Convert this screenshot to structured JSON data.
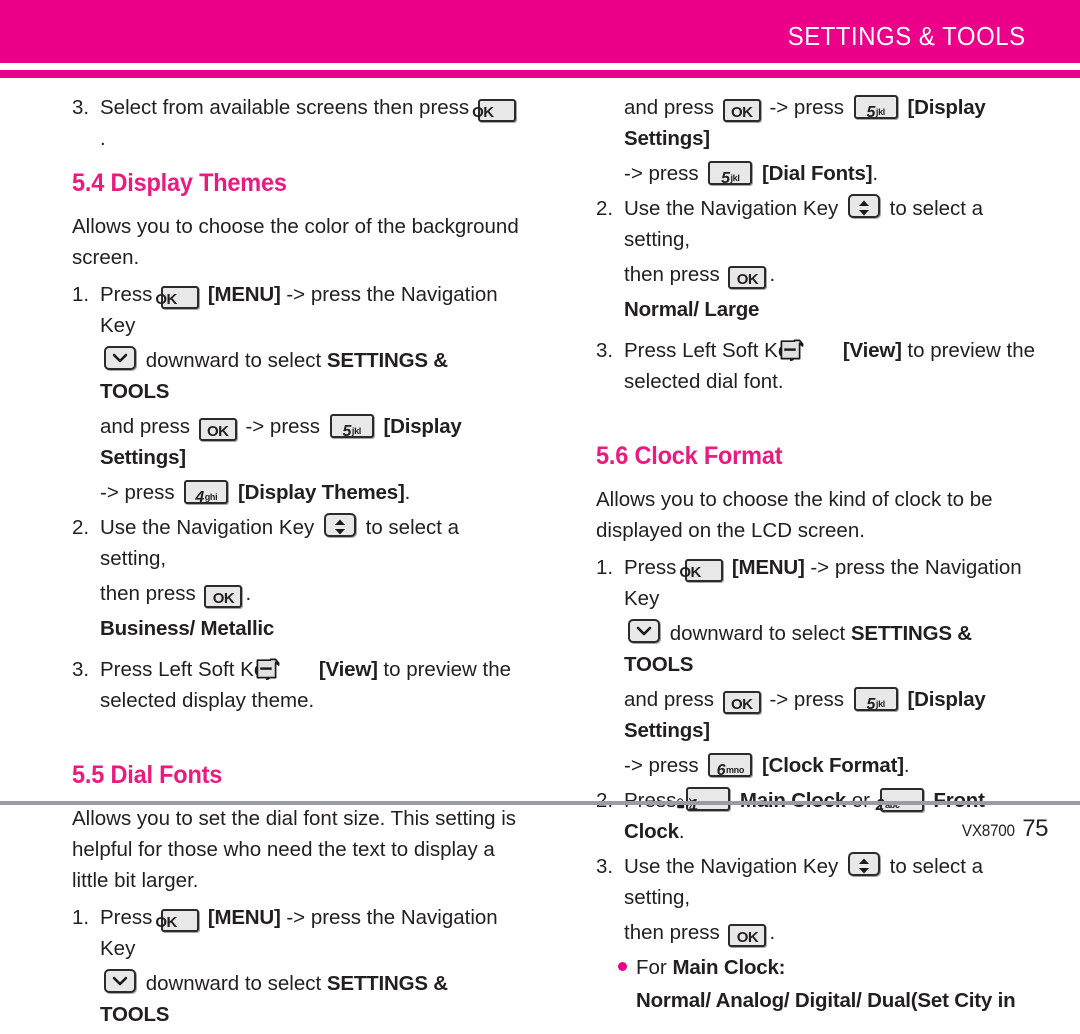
{
  "header": {
    "title": "SETTINGS & TOOLS",
    "band_color": "#ec0089"
  },
  "footer": {
    "model": "VX8700",
    "page": "75",
    "rule_color": "#9b9ba8"
  },
  "theme": {
    "heading_color": "#ec1a7e",
    "body_color": "#231f20",
    "bullet_color": "#ec0089"
  },
  "left_column": {
    "step3_prev": {
      "num": "3.",
      "text_before": "Select from available screens then press",
      "key": "OK",
      "text_after": "."
    },
    "display_themes": {
      "heading": "5.4 Display Themes",
      "intro": "Allows you to choose the color of the background screen.",
      "step1": {
        "num": "1.",
        "a": "Press",
        "key_ok1": "OK",
        "b": "[MENU]",
        "c": "-> press the Navigation Key",
        "d": "downward to select",
        "e": "SETTINGS & TOOLS",
        "f": "and press",
        "key_ok2": "OK",
        "g": "-> press",
        "key_num1_digit": "5",
        "key_num1_sub": "jkl",
        "h": "[Display Settings]",
        "i": "-> press",
        "key_num2_digit": "4",
        "key_num2_sub": "ghi",
        "j": "[Display Themes]",
        "k": "."
      },
      "step2": {
        "num": "2.",
        "a": "Use the Navigation Key",
        "b": "to select a setting,",
        "c": "then press",
        "key_ok": "OK",
        "d": "."
      },
      "options": "Business/ Metallic",
      "step3": {
        "num": "3.",
        "a": "Press Left Soft Key",
        "b": "[View]",
        "c": "to preview the selected display theme."
      }
    },
    "dial_fonts": {
      "heading": "5.5 Dial Fonts",
      "intro": "Allows you to set the dial font size. This setting is helpful for those who need the text to display a little bit larger.",
      "step1": {
        "num": "1.",
        "a": "Press",
        "key_ok": "OK",
        "b": "[MENU]",
        "c": "-> press the Navigation Key",
        "d": "downward to select",
        "e": "SETTINGS & TOOLS"
      }
    }
  },
  "right_column": {
    "dial_fonts_cont": {
      "a": "and press",
      "key_ok": "OK",
      "b": "-> press",
      "key_num1_digit": "5",
      "key_num1_sub": "jkl",
      "c": "[Display Settings]",
      "d": "-> press",
      "key_num2_digit": "5",
      "key_num2_sub": "jkl",
      "e": "[Dial Fonts]",
      "f": ".",
      "step2": {
        "num": "2.",
        "a": "Use the Navigation Key",
        "b": "to select a setting,",
        "c": "then press",
        "key_ok": "OK",
        "d": "."
      },
      "options": "Normal/ Large",
      "step3": {
        "num": "3.",
        "a": "Press Left Soft Key",
        "b": "[View]",
        "c": "to preview the selected dial font."
      }
    },
    "clock_format": {
      "heading": "5.6 Clock Format",
      "intro": "Allows you to choose the kind of clock to be displayed on the LCD screen.",
      "step1": {
        "num": "1.",
        "a": "Press",
        "key_ok1": "OK",
        "b": "[MENU]",
        "c": "-> press the Navigation Key",
        "d": "downward to select",
        "e": "SETTINGS & TOOLS",
        "f": "and press",
        "key_ok2": "OK",
        "g": "-> press",
        "key_num1_digit": "5",
        "key_num1_sub": "jkl",
        "h": "[Display Settings]",
        "i": "-> press",
        "key_num2_digit": "6",
        "key_num2_sub": "mno",
        "j": "[Clock Format]",
        "k": "."
      },
      "step2": {
        "num": "2.",
        "a": "Press",
        "key_num1_digit": "1",
        "b": "Main Clock",
        "c": "or",
        "key_num2_digit": "2",
        "key_num2_sub": "abc",
        "d": "Front Clock",
        "e": "."
      },
      "step3": {
        "num": "3.",
        "a": "Use the Navigation Key",
        "b": "to select a setting,",
        "c": "then press",
        "key_ok": "OK",
        "d": "."
      },
      "bullet": {
        "a": "For",
        "b": "Main Clock:"
      },
      "options": "Normal/ Analog/ Digital/ Dual(Set City in"
    }
  }
}
